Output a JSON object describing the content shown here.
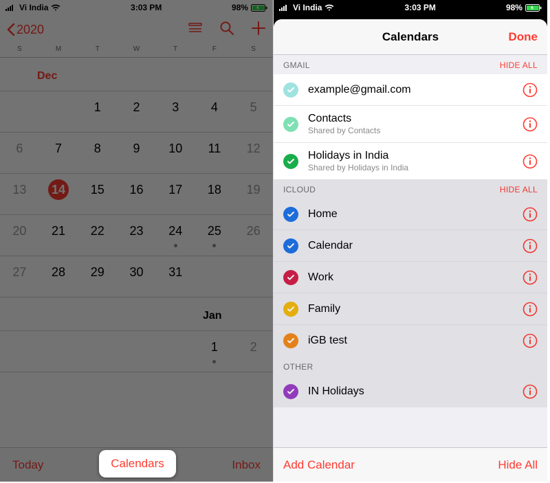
{
  "status": {
    "carrier": "Vi India",
    "time": "3:03 PM",
    "battery": "98%"
  },
  "calendar": {
    "year": "2020",
    "weekdays": [
      "S",
      "M",
      "T",
      "W",
      "T",
      "F",
      "S"
    ],
    "month1": "Dec",
    "month2": "Jan",
    "dec_rows": [
      [
        null,
        null,
        "1",
        "2",
        "3",
        "4",
        "5"
      ],
      [
        "6",
        "7",
        "8",
        "9",
        "10",
        "11",
        "12"
      ],
      [
        "13",
        "14",
        "15",
        "16",
        "17",
        "18",
        "19"
      ],
      [
        "20",
        "21",
        "22",
        "23",
        "24",
        "25",
        "26"
      ],
      [
        "27",
        "28",
        "29",
        "30",
        "31",
        null,
        null
      ]
    ],
    "today": "14",
    "dots": [
      "24",
      "25"
    ],
    "jan_row": [
      null,
      null,
      null,
      null,
      null,
      "1",
      "2"
    ],
    "jan_dots": [
      "1"
    ],
    "bottom": {
      "today": "Today",
      "calendars": "Calendars",
      "inbox": "Inbox"
    }
  },
  "sheet": {
    "title": "Calendars",
    "done": "Done",
    "gmail": {
      "header": "GMAIL",
      "hide": "HIDE ALL",
      "items": [
        {
          "title": "example@gmail.com",
          "sub": null,
          "color": "#9fe3e0"
        },
        {
          "title": "Contacts",
          "sub": "Shared by Contacts",
          "color": "#7fe0b3"
        },
        {
          "title": "Holidays in India",
          "sub": "Shared by Holidays in India",
          "color": "#1aad4b"
        }
      ]
    },
    "icloud": {
      "header": "ICLOUD",
      "hide": "HIDE ALL",
      "items": [
        {
          "title": "Home",
          "color": "#1e73e8"
        },
        {
          "title": "Calendar",
          "color": "#1e73e8"
        },
        {
          "title": "Work",
          "color": "#d21f4a"
        },
        {
          "title": "Family",
          "color": "#f2b90f"
        },
        {
          "title": "iGB test",
          "color": "#f28a1c"
        }
      ]
    },
    "other": {
      "header": "OTHER",
      "items": [
        {
          "title": "IN Holidays",
          "color": "#9b3fc7"
        }
      ]
    },
    "footer": {
      "add": "Add Calendar",
      "hide": "Hide All"
    }
  }
}
